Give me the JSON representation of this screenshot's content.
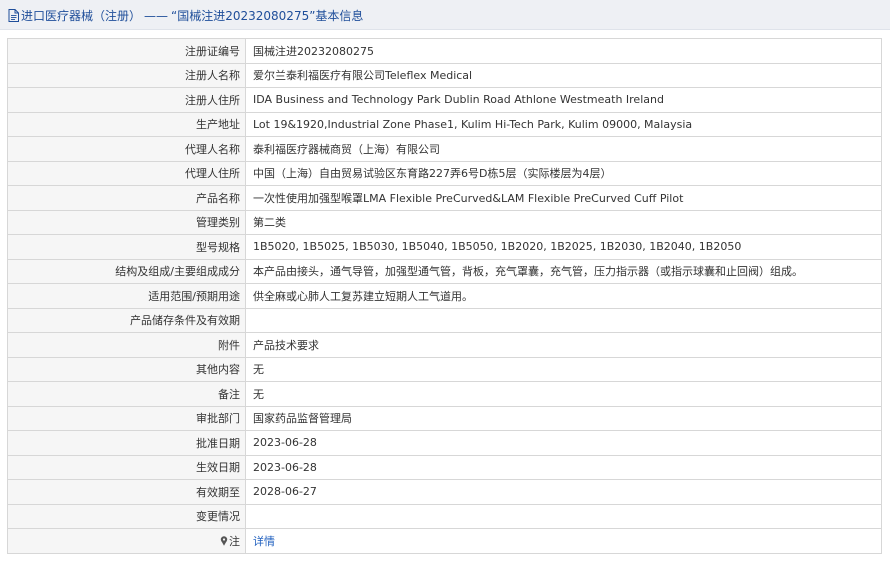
{
  "header": {
    "icon": "document-icon",
    "breadcrumb_prefix": "进口医疗器械（注册）",
    "separator": "——",
    "title_suffix": "“国械注进20232080275”基本信息",
    "color": "#1f4e9a"
  },
  "rows": [
    {
      "label": "注册证编号",
      "value": "国械注进20232080275"
    },
    {
      "label": "注册人名称",
      "value": "爱尔兰泰利福医疗有限公司Teleflex Medical"
    },
    {
      "label": "注册人住所",
      "value": "IDA Business and Technology Park Dublin Road Athlone Westmeath Ireland"
    },
    {
      "label": "生产地址",
      "value": "Lot 19&1920,Industrial Zone Phase1, Kulim Hi-Tech Park, Kulim 09000, Malaysia"
    },
    {
      "label": "代理人名称",
      "value": "泰利福医疗器械商贸（上海）有限公司"
    },
    {
      "label": "代理人住所",
      "value": "中国（上海）自由贸易试验区东育路227弄6号D栋5层（实际楼层为4层）"
    },
    {
      "label": "产品名称",
      "value": "一次性使用加强型喉罩LMA Flexible PreCurved&LAM Flexible PreCurved Cuff Pilot"
    },
    {
      "label": "管理类别",
      "value": "第二类"
    },
    {
      "label": "型号规格",
      "value": "1B5020, 1B5025, 1B5030, 1B5040, 1B5050, 1B2020, 1B2025, 1B2030, 1B2040, 1B2050"
    },
    {
      "label": "结构及组成/主要组成成分",
      "value": "本产品由接头，通气导管，加强型通气管，背板，充气罩囊，充气管，压力指示器（或指示球囊和止回阀）组成。"
    },
    {
      "label": "适用范围/预期用途",
      "value": "供全麻或心肺人工复苏建立短期人工气道用。"
    },
    {
      "label": "产品储存条件及有效期",
      "value": ""
    },
    {
      "label": "附件",
      "value": "产品技术要求"
    },
    {
      "label": "其他内容",
      "value": "无"
    },
    {
      "label": "备注",
      "value": "无"
    },
    {
      "label": "审批部门",
      "value": "国家药品监督管理局"
    },
    {
      "label": "批准日期",
      "value": "2023-06-28"
    },
    {
      "label": "生效日期",
      "value": "2023-06-28"
    },
    {
      "label": "有效期至",
      "value": "2028-06-27"
    },
    {
      "label": "变更情况",
      "value": ""
    }
  ],
  "note_row": {
    "icon": "pin-icon",
    "label": "注",
    "link_text": "详情",
    "link_color": "#1f5fbf"
  }
}
